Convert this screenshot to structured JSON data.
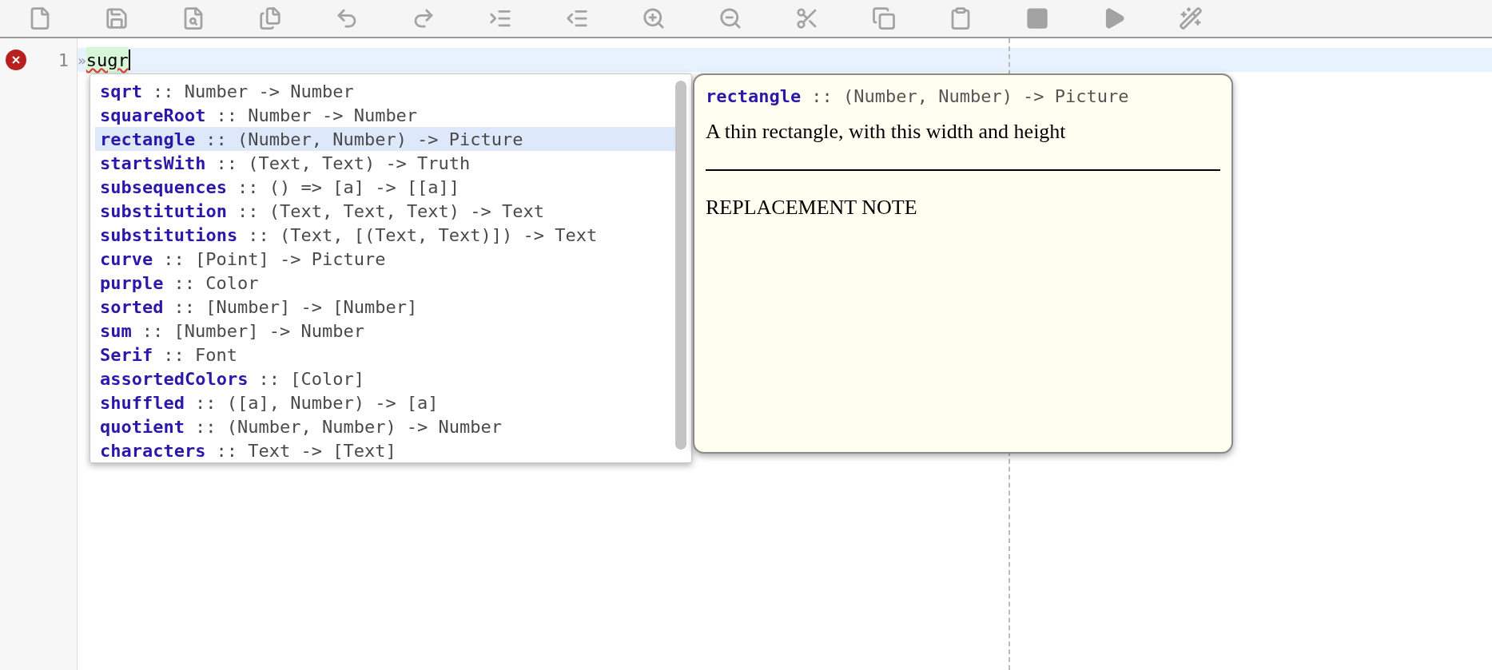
{
  "editor": {
    "line_number": "1",
    "error": true,
    "marker": "»",
    "typed": "sugr"
  },
  "completions": [
    {
      "name": "sqrt",
      "type": ":: Number -> Number",
      "selected": false
    },
    {
      "name": "squareRoot",
      "type": ":: Number -> Number",
      "selected": false
    },
    {
      "name": "rectangle",
      "type": ":: (Number, Number) -> Picture",
      "selected": true
    },
    {
      "name": "startsWith",
      "type": ":: (Text, Text) -> Truth",
      "selected": false
    },
    {
      "name": "subsequences",
      "type": ":: () => [a] -> [[a]]",
      "selected": false
    },
    {
      "name": "substitution",
      "type": ":: (Text, Text, Text) -> Text",
      "selected": false
    },
    {
      "name": "substitutions",
      "type": ":: (Text, [(Text, Text)]) -> Text",
      "selected": false
    },
    {
      "name": "curve",
      "type": ":: [Point] -> Picture",
      "selected": false
    },
    {
      "name": "purple",
      "type": ":: Color",
      "selected": false
    },
    {
      "name": "sorted",
      "type": ":: [Number] -> [Number]",
      "selected": false
    },
    {
      "name": "sum",
      "type": ":: [Number] -> Number",
      "selected": false
    },
    {
      "name": "Serif",
      "type": ":: Font",
      "selected": false
    },
    {
      "name": "assortedColors",
      "type": ":: [Color]",
      "selected": false
    },
    {
      "name": "shuffled",
      "type": ":: ([a], Number) -> [a]",
      "selected": false
    },
    {
      "name": "quotient",
      "type": ":: (Number, Number) -> Number",
      "selected": false
    },
    {
      "name": "characters",
      "type": ":: Text -> [Text]",
      "selected": false
    }
  ],
  "doc_popup": {
    "name": "rectangle",
    "type": ":: (Number, Number) -> Picture",
    "description": "A thin rectangle, with this width and height",
    "note": "REPLACEMENT NOTE"
  }
}
